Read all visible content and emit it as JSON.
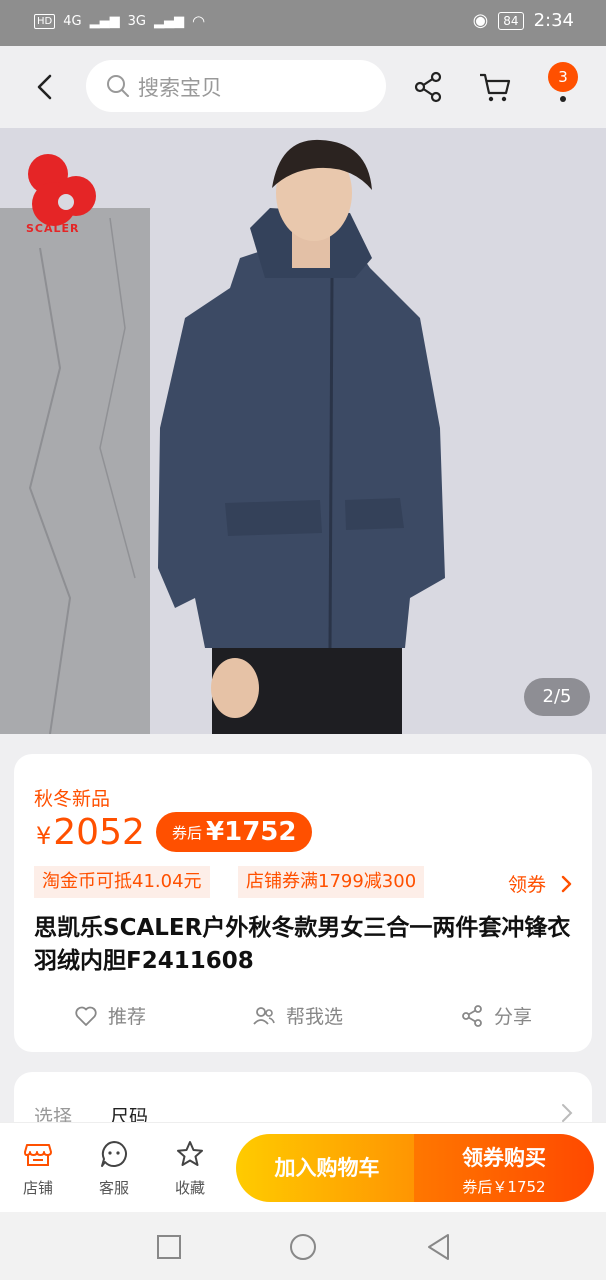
{
  "status_bar": {
    "hd": "HD",
    "net1": "4G",
    "net2": "3G",
    "battery": "84",
    "time": "2:34"
  },
  "top_nav": {
    "search_placeholder": "搜索宝贝",
    "message_count": "3"
  },
  "hero": {
    "brand": "SCALER",
    "page_counter": "2/5"
  },
  "product": {
    "tag": "秋冬新品",
    "currency": "¥",
    "price": "2052",
    "coupon_label": "券后",
    "coupon_price": "¥1752",
    "chips": [
      "淘金币可抵41.04元",
      "店铺券满1799减300"
    ],
    "get_coupon": "领券",
    "title": "思凯乐SCALER户外秋冬款男女三合一两件套冲锋衣羽绒内胆F2411608",
    "actions": [
      "推荐",
      "帮我选",
      "分享"
    ]
  },
  "select_section": {
    "label": "选择",
    "value": "尺码"
  },
  "bottom_bar": {
    "tabs": [
      "店铺",
      "客服",
      "收藏"
    ],
    "add_to_cart": "加入购物车",
    "buy_label": "领券购买",
    "buy_sub": "券后￥1752"
  },
  "colors": {
    "accent": "#ff5000",
    "cart_button": "#ffab00",
    "buy_button": "#ff5a00",
    "jacket": "#3c4a64"
  }
}
